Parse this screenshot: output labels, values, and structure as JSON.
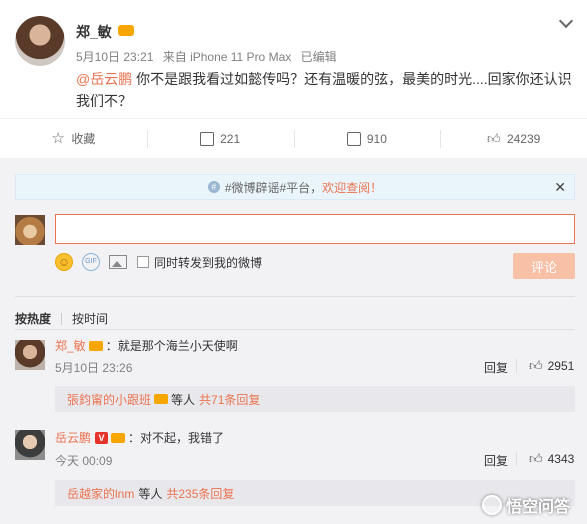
{
  "post": {
    "author": "郑_敏",
    "timestamp": "5月10日 23:21",
    "source": "来自 iPhone 11 Pro Max",
    "edited": "已编辑",
    "mention": "@岳云鹏",
    "text_line1": " 你不是跟我看过如懿传吗？还有温暖的弦，最美的时光....回家你还认识",
    "text_line2": "我们不？"
  },
  "actions": {
    "favorite": "收藏",
    "reposts": "221",
    "comments": "910",
    "likes": "24239"
  },
  "notice": {
    "text": "#微博辟谣#平台，",
    "link": "欢迎查阅！"
  },
  "composer": {
    "repost_label": "同时转发到我的微博",
    "submit_label": "评论",
    "input_value": ""
  },
  "sort": {
    "by_hot": "按热度",
    "by_time": "按时间"
  },
  "comments": [
    {
      "user": "郑_敏",
      "text": "：就是那个海兰小天使啊",
      "time": "5月10日 23:26",
      "reply_label": "回复",
      "likes": "2951",
      "sub_user": "張鈞甯的小跟班",
      "sub_mid": "等人",
      "sub_count": "共71条回复"
    },
    {
      "user": "岳云鹏",
      "verified_badge": "V",
      "text": "：对不起，我错了",
      "time": "今天 00:09",
      "reply_label": "回复",
      "likes": "4343",
      "sub_user": "岳越家的lnm",
      "sub_mid": "等人",
      "sub_count": "共235条回复"
    }
  ],
  "watermark": "悟空问答",
  "colors": {
    "accent": "#eb7350",
    "verified": "#e6342c",
    "vip": "#f7a600"
  }
}
